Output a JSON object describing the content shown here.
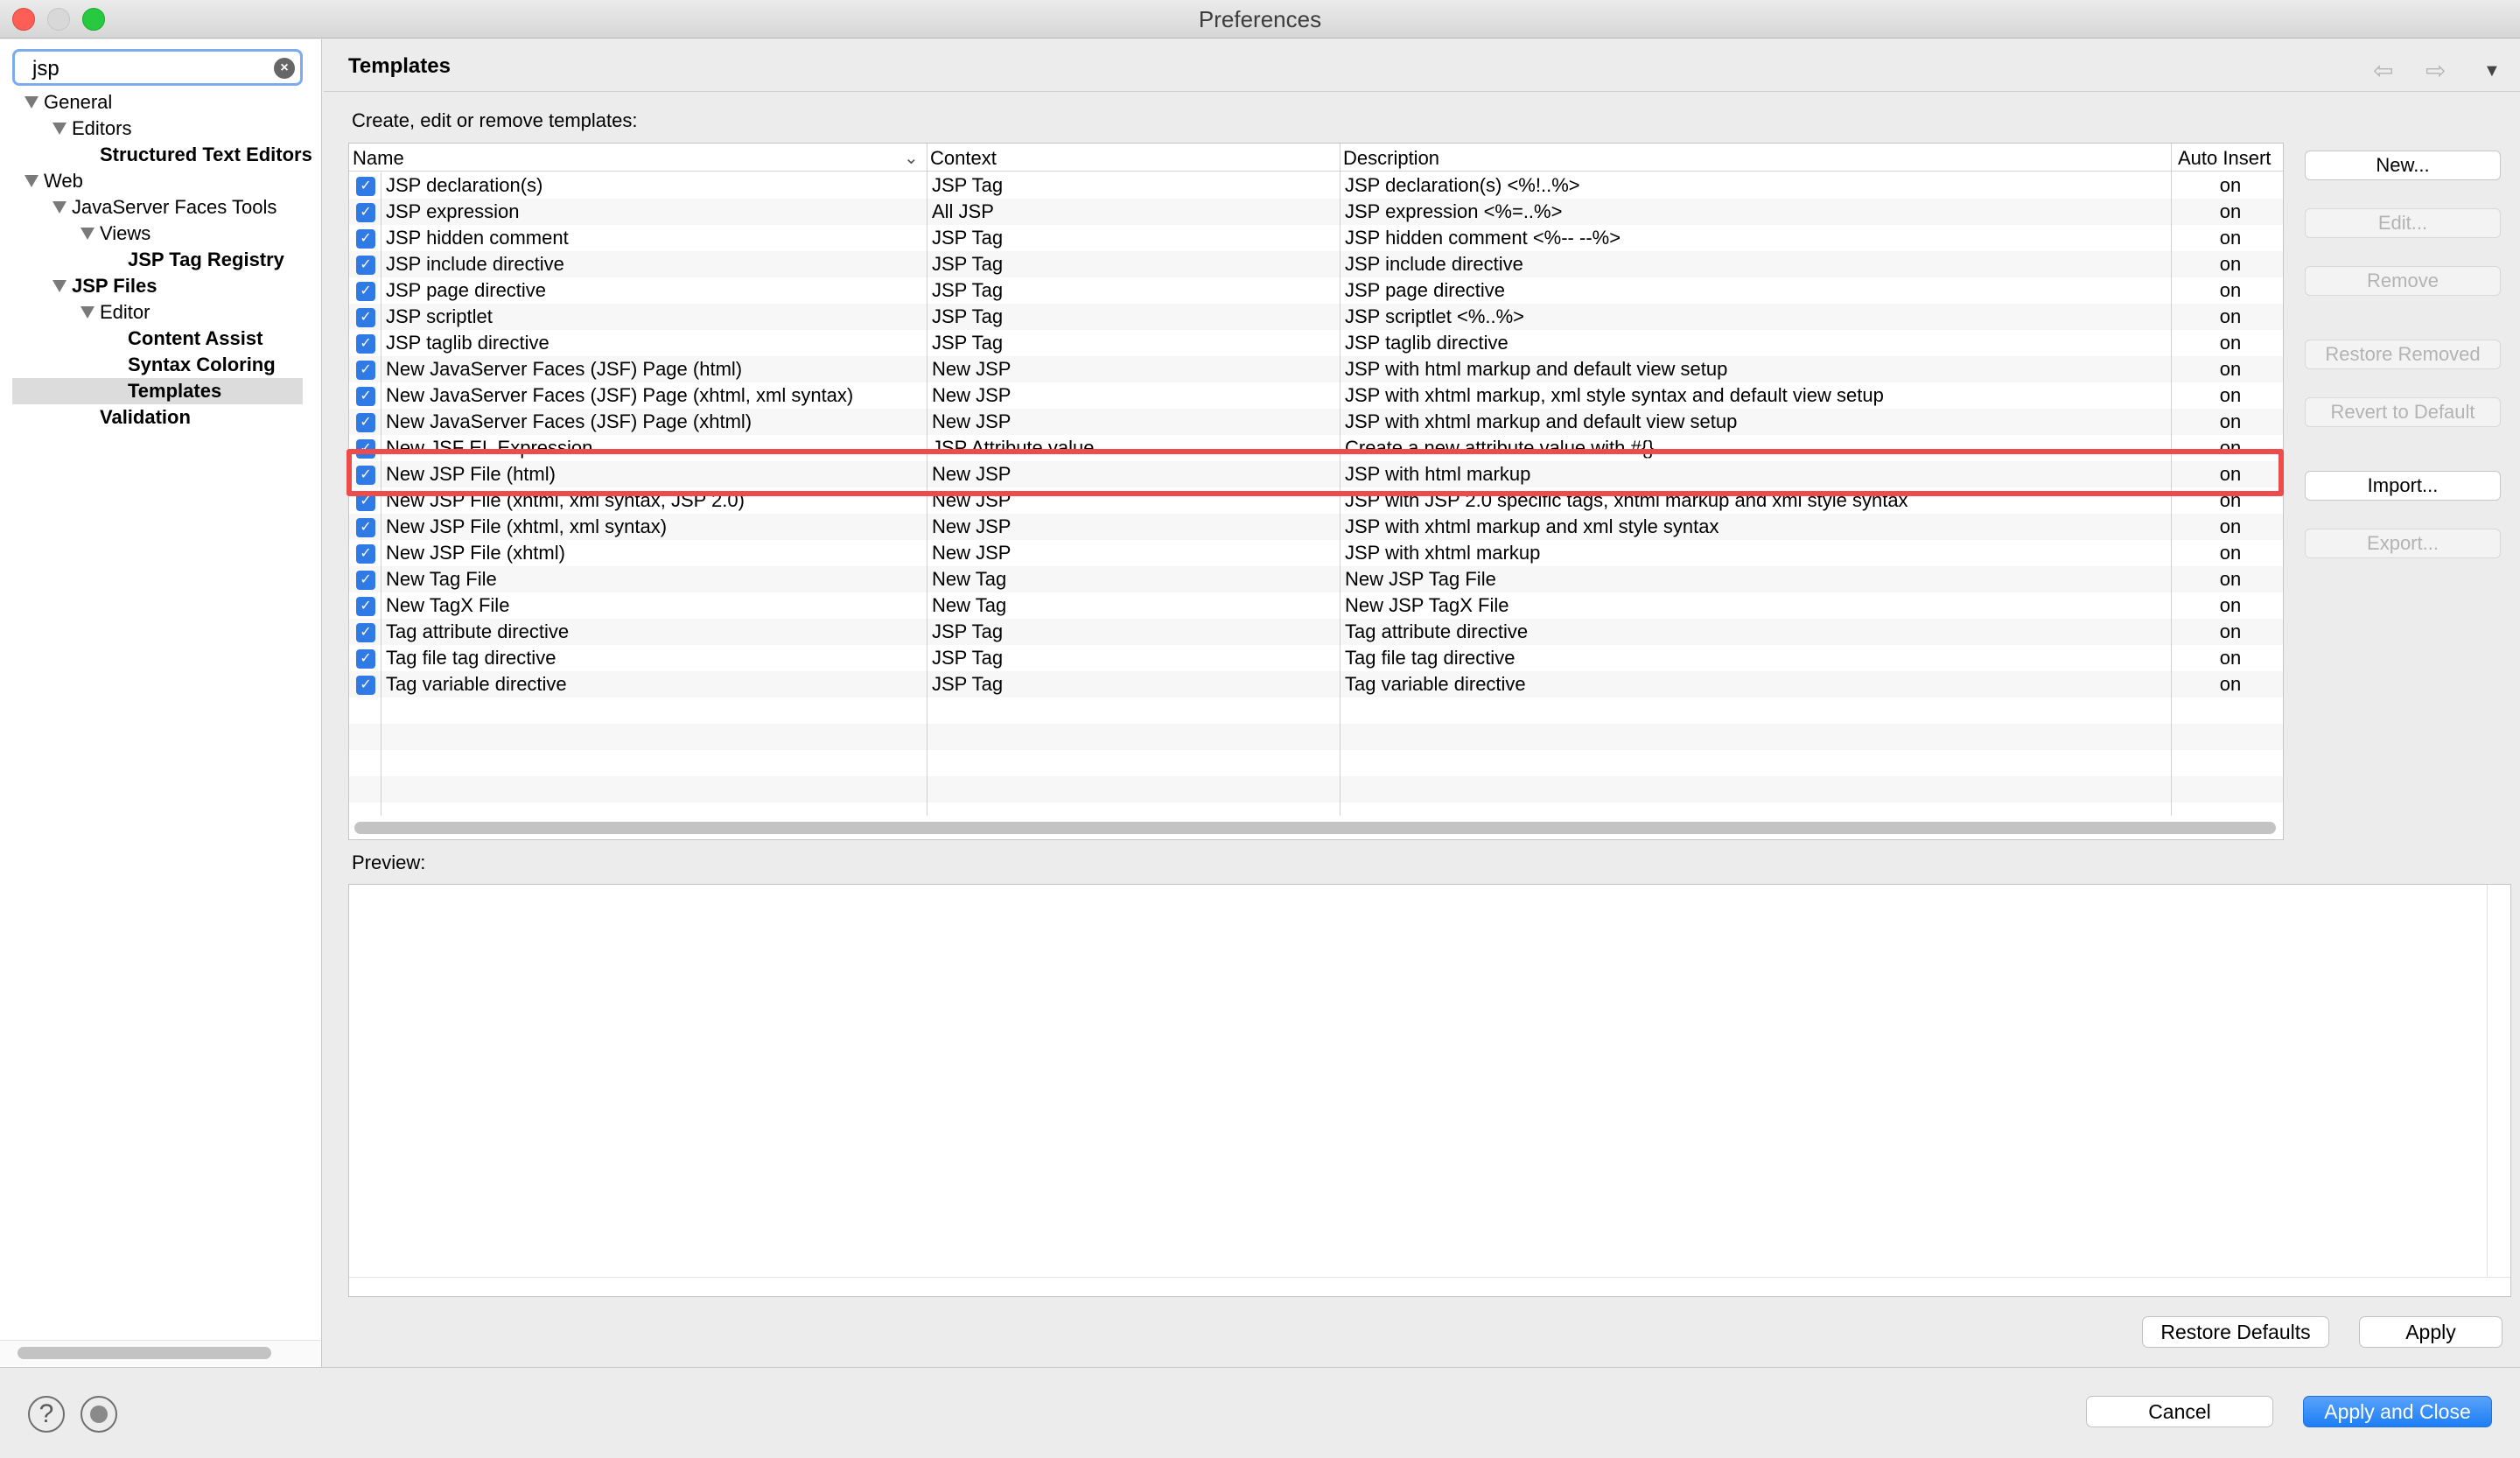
{
  "window": {
    "title": "Preferences"
  },
  "search": {
    "value": "jsp"
  },
  "tree": [
    {
      "label": "General",
      "indent": 0,
      "bold": false,
      "expanded": true
    },
    {
      "label": "Editors",
      "indent": 1,
      "bold": false,
      "expanded": true
    },
    {
      "label": "Structured Text Editors",
      "indent": 2,
      "bold": true,
      "expanded": false
    },
    {
      "label": "Web",
      "indent": 0,
      "bold": false,
      "expanded": true
    },
    {
      "label": "JavaServer Faces Tools",
      "indent": 1,
      "bold": false,
      "expanded": true
    },
    {
      "label": "Views",
      "indent": 2,
      "bold": false,
      "expanded": true
    },
    {
      "label": "JSP Tag Registry",
      "indent": 3,
      "bold": true,
      "expanded": false
    },
    {
      "label": "JSP Files",
      "indent": 1,
      "bold": true,
      "expanded": true
    },
    {
      "label": "Editor",
      "indent": 2,
      "bold": false,
      "expanded": true
    },
    {
      "label": "Content Assist",
      "indent": 3,
      "bold": true,
      "expanded": false
    },
    {
      "label": "Syntax Coloring",
      "indent": 3,
      "bold": true,
      "expanded": false
    },
    {
      "label": "Templates",
      "indent": 3,
      "bold": true,
      "expanded": false,
      "selected": true
    },
    {
      "label": "Validation",
      "indent": 2,
      "bold": true,
      "expanded": false
    }
  ],
  "page": {
    "title": "Templates",
    "description": "Create, edit or remove templates:",
    "preview_label": "Preview:"
  },
  "table": {
    "headers": {
      "name": "Name",
      "context": "Context",
      "description": "Description",
      "auto_insert": "Auto Insert"
    },
    "rows": [
      {
        "name": "JSP declaration(s)",
        "context": "JSP Tag",
        "description": "JSP declaration(s) <%!..%>",
        "auto": "on"
      },
      {
        "name": "JSP expression",
        "context": "All JSP",
        "description": "JSP expression <%=..%>",
        "auto": "on"
      },
      {
        "name": "JSP hidden comment",
        "context": "JSP Tag",
        "description": "JSP hidden comment <%-- --%>",
        "auto": "on"
      },
      {
        "name": "JSP include directive",
        "context": "JSP Tag",
        "description": "JSP include directive",
        "auto": "on"
      },
      {
        "name": "JSP page directive",
        "context": "JSP Tag",
        "description": "JSP page directive",
        "auto": "on"
      },
      {
        "name": "JSP scriptlet",
        "context": "JSP Tag",
        "description": "JSP scriptlet <%..%>",
        "auto": "on"
      },
      {
        "name": "JSP taglib directive",
        "context": "JSP Tag",
        "description": "JSP taglib directive",
        "auto": "on"
      },
      {
        "name": "New JavaServer Faces (JSF) Page (html)",
        "context": "New JSP",
        "description": "JSP with html markup and default view setup",
        "auto": "on"
      },
      {
        "name": "New JavaServer Faces (JSF) Page (xhtml, xml syntax)",
        "context": "New JSP",
        "description": "JSP with xhtml markup, xml style syntax and default view setup",
        "auto": "on"
      },
      {
        "name": "New JavaServer Faces (JSF) Page (xhtml)",
        "context": "New JSP",
        "description": "JSP with xhtml markup and default view setup",
        "auto": "on"
      },
      {
        "name": "New JSF EL Expression",
        "context": "JSP Attribute value",
        "description": "Create a new attribute value with #{}",
        "auto": "on"
      },
      {
        "name": "New JSP File (html)",
        "context": "New JSP",
        "description": "JSP with html markup",
        "auto": "on"
      },
      {
        "name": "New JSP File (xhtml, xml syntax, JSP 2.0)",
        "context": "New JSP",
        "description": "JSP with JSP 2.0 specific tags, xhtml markup and xml style syntax",
        "auto": "on"
      },
      {
        "name": "New JSP File (xhtml, xml syntax)",
        "context": "New JSP",
        "description": "JSP with xhtml markup and xml style syntax",
        "auto": "on"
      },
      {
        "name": "New JSP File (xhtml)",
        "context": "New JSP",
        "description": "JSP with xhtml markup",
        "auto": "on"
      },
      {
        "name": "New Tag File",
        "context": "New Tag",
        "description": "New JSP Tag File",
        "auto": "on"
      },
      {
        "name": "New TagX File",
        "context": "New Tag",
        "description": "New JSP TagX File",
        "auto": "on"
      },
      {
        "name": "Tag attribute directive",
        "context": "JSP Tag",
        "description": "Tag attribute directive",
        "auto": "on"
      },
      {
        "name": "Tag file tag directive",
        "context": "JSP Tag",
        "description": "Tag file tag directive",
        "auto": "on"
      },
      {
        "name": "Tag variable directive",
        "context": "JSP Tag",
        "description": "Tag variable directive",
        "auto": "on"
      }
    ]
  },
  "side_buttons": {
    "new": "New...",
    "edit": "Edit...",
    "remove": "Remove",
    "restore_removed": "Restore Removed",
    "revert": "Revert to Default",
    "import": "Import...",
    "export": "Export..."
  },
  "buttons": {
    "restore_defaults": "Restore Defaults",
    "apply": "Apply",
    "cancel": "Cancel",
    "apply_close": "Apply and Close"
  },
  "icons": {
    "help": "?",
    "clear": "×",
    "check": "✓",
    "back": "⇦",
    "forward": "⇨",
    "menu": "▼",
    "sort": "⌄"
  },
  "colors": {
    "accent": "#2f7ae5",
    "highlight": "#ef4b4b"
  }
}
